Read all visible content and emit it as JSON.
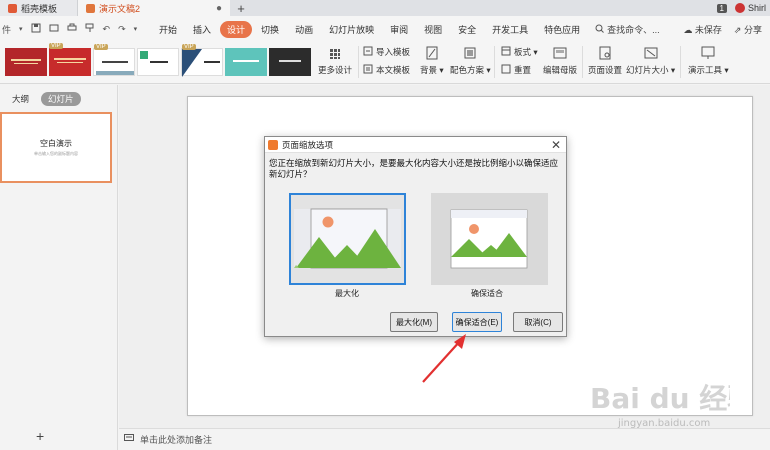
{
  "tabs": [
    {
      "label": "稻壳模板",
      "color": "#e05a37"
    },
    {
      "label": "演示文稿2",
      "color": "#e0763c"
    }
  ],
  "tabbar": {
    "count": "1",
    "user": "Shirl"
  },
  "quick_access": {
    "file_label": "件"
  },
  "menu": [
    "开始",
    "插入",
    "设计",
    "切换",
    "动画",
    "幻灯片放映",
    "审阅",
    "视图",
    "安全",
    "开发工具",
    "特色应用"
  ],
  "menu_active": "设计",
  "search": {
    "label": "查找命令、..."
  },
  "menu_right": {
    "unsaved": "未保存",
    "share": "分享"
  },
  "ribbon": {
    "vip": "VIP",
    "more_design": "更多设计",
    "import_template": "导入模板",
    "text_template": "本文模板",
    "background": "背景",
    "color_scheme": "配色方案",
    "layout": "板式",
    "reset": "重置",
    "edit_master": "编辑母版",
    "page_setup": "页面设置",
    "slide_size": "幻灯片大小",
    "presentation_tools": "演示工具"
  },
  "left_panel": {
    "outline_tab": "大纲",
    "slides_tab": "幻灯片",
    "slide_title": "空白演示",
    "slide_subtitle": "单击输入您的副标题内容"
  },
  "notes": {
    "placeholder": "单击此处添加备注"
  },
  "dialog": {
    "title": "页面缩放选项",
    "message": "您正在缩放到新幻灯片大小，是要最大化内容大小还是按比例缩小以确保适应新幻灯片？",
    "option_maximize": "最大化",
    "option_ensure_fit": "确保适合",
    "btn_maximize": "最大化(M)",
    "btn_ensure_fit": "确保适合(E)",
    "btn_cancel": "取消(C)"
  },
  "watermark": {
    "brand": "Bai du 经验",
    "url": "jingyan.baidu.com"
  },
  "colors": {
    "accent": "#e8744a",
    "selection": "#2e83d8",
    "mountain": "#6db33f",
    "sun": "#f0956a"
  }
}
